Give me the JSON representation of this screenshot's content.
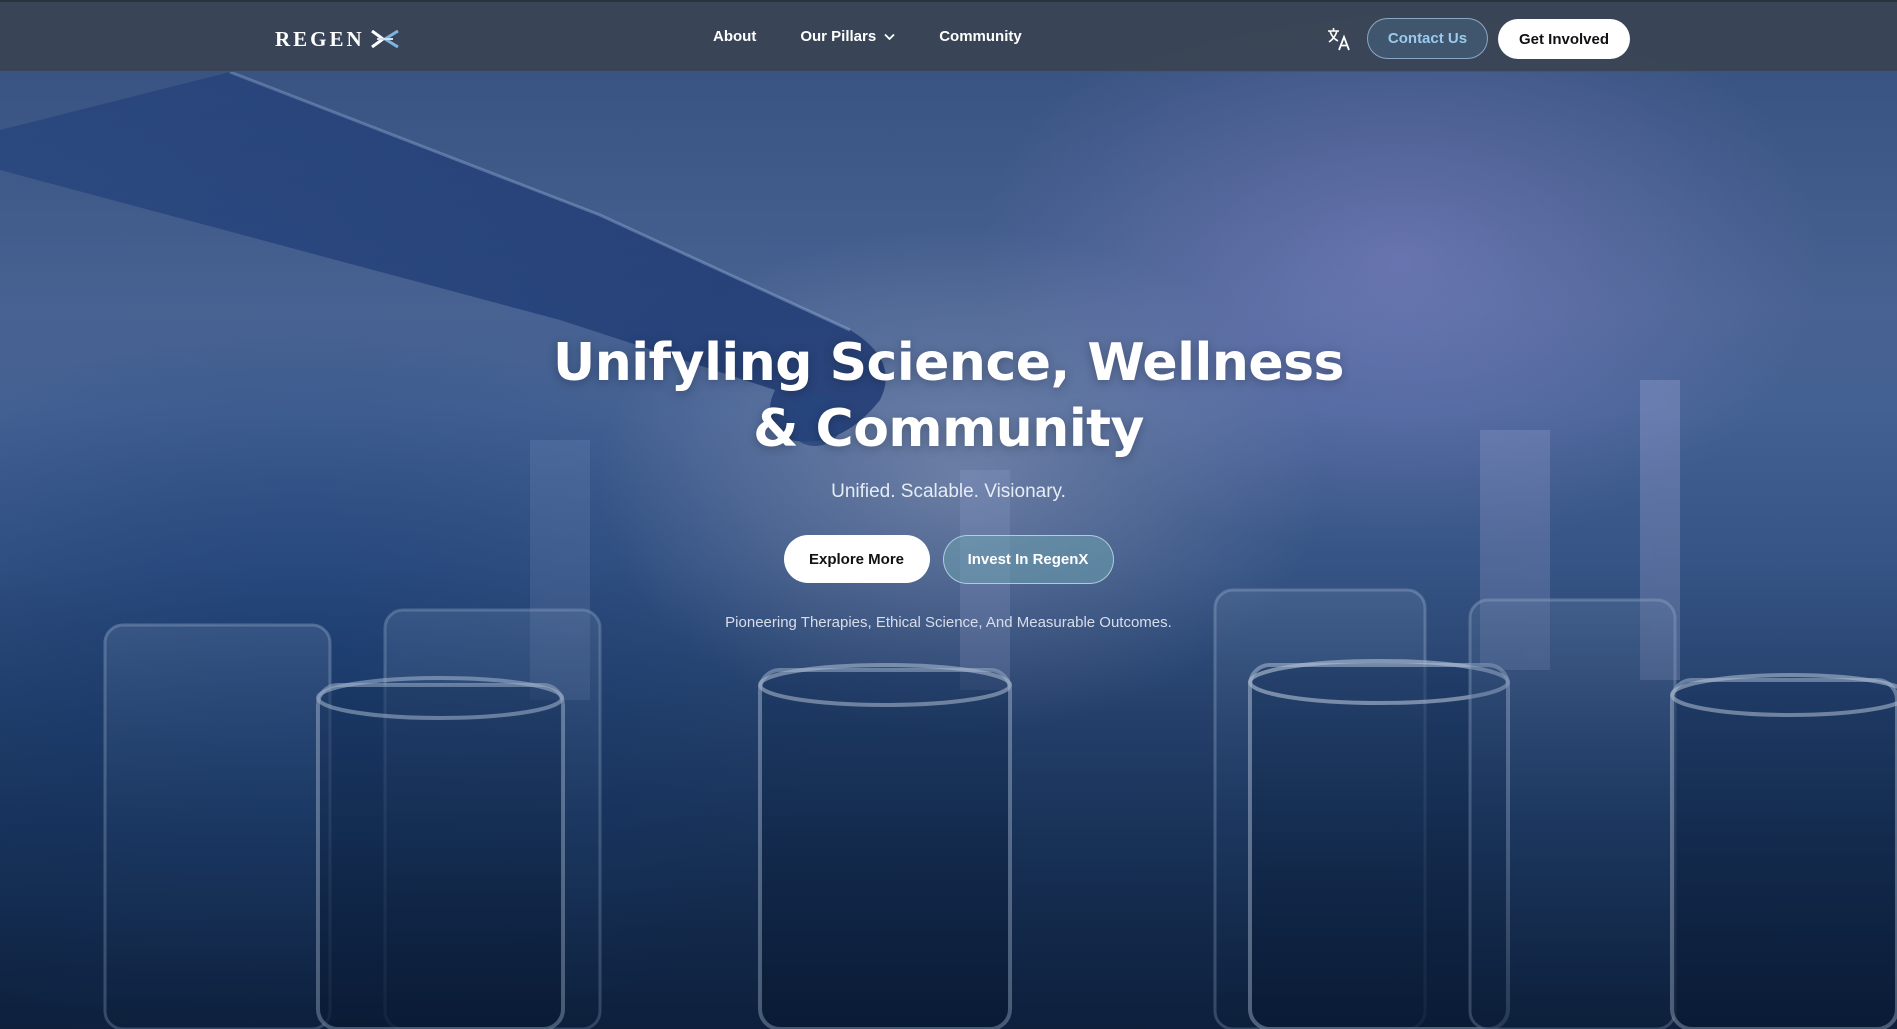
{
  "brand": {
    "logo_text": "REGEN",
    "logo_mark_icon": "regenx-x-mark-icon"
  },
  "nav": {
    "links": [
      {
        "label": "About"
      },
      {
        "label": "Our Pillars",
        "icon": "chevron-down-icon"
      },
      {
        "label": "Community"
      }
    ],
    "translate_icon": "translate-icon",
    "contact_label": "Contact Us",
    "get_involved_label": "Get Involved"
  },
  "hero": {
    "title": "Unifyling Science, Wellness & Community",
    "subtitle": "Unified. Scalable. Visionary.",
    "primary_cta": "Explore More",
    "secondary_cta": "Invest In RegenX",
    "tagline": "Pioneering Therapies, Ethical Science, And Measurable Outcomes."
  },
  "colors": {
    "nav_bg": "#3a4452",
    "contact_text": "#9cc9ec",
    "hero_bg": "#3a5a8e",
    "white": "#ffffff"
  }
}
